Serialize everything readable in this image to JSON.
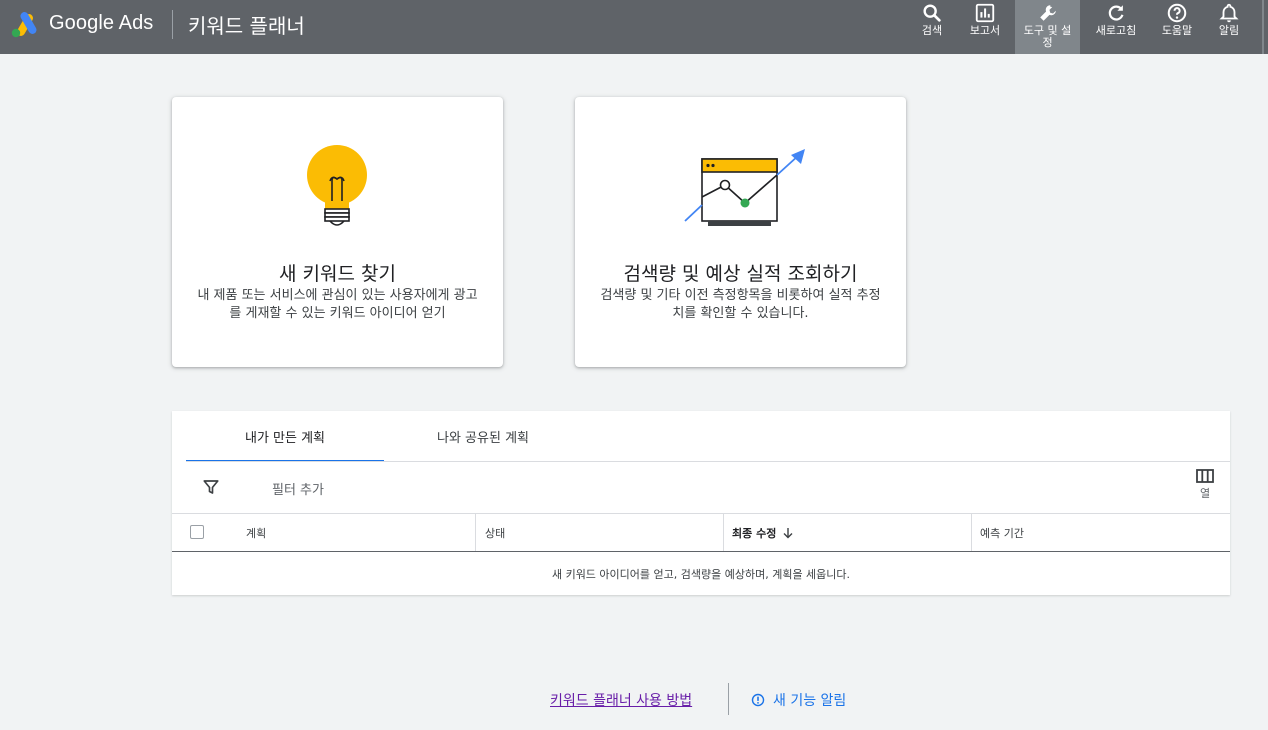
{
  "header": {
    "brand": "Google Ads",
    "page_title": "키워드 플래너",
    "actions": [
      {
        "label": "검색",
        "icon": "search-icon"
      },
      {
        "label": "보고서",
        "icon": "reports-icon"
      },
      {
        "label": "도구 및 설정",
        "icon": "wrench-icon",
        "active": true
      },
      {
        "label": "새로고침",
        "icon": "refresh-icon"
      },
      {
        "label": "도움말",
        "icon": "help-icon"
      },
      {
        "label": "알림",
        "icon": "bell-icon"
      }
    ]
  },
  "cards": [
    {
      "title": "새 키워드 찾기",
      "description": "내 제품 또는 서비스에 관심이 있는 사용자에게 광고를 게재할 수 있는 키워드 아이디어 얻기",
      "icon": "lightbulb-icon"
    },
    {
      "title": "검색량 및 예상 실적 조회하기",
      "description": "검색량 및 기타 이전 측정항목을 비롯하여 실적 추정치를 확인할 수 있습니다.",
      "icon": "trend-chart-icon"
    }
  ],
  "plans": {
    "tabs": [
      {
        "label": "내가 만든 계획",
        "active": true
      },
      {
        "label": "나와 공유된 계획",
        "active": false
      }
    ],
    "filter_label": "필터 추가",
    "columns_label": "열",
    "table_headers": [
      "계획",
      "상태",
      "최종 수정",
      "예측 기간"
    ],
    "empty_message": "새 키워드 아이디어를 얻고, 검색량을 예상하며, 계획을 세웁니다."
  },
  "footer": {
    "help_link": "키워드 플래너 사용 방법",
    "news_link": "새 기능 알림"
  },
  "colors": {
    "header_bg": "#5f6368",
    "accent_blue": "#1a73e8",
    "bulb_yellow": "#fbbc04",
    "link_visited": "#681da8",
    "trend_green": "#34a853"
  }
}
